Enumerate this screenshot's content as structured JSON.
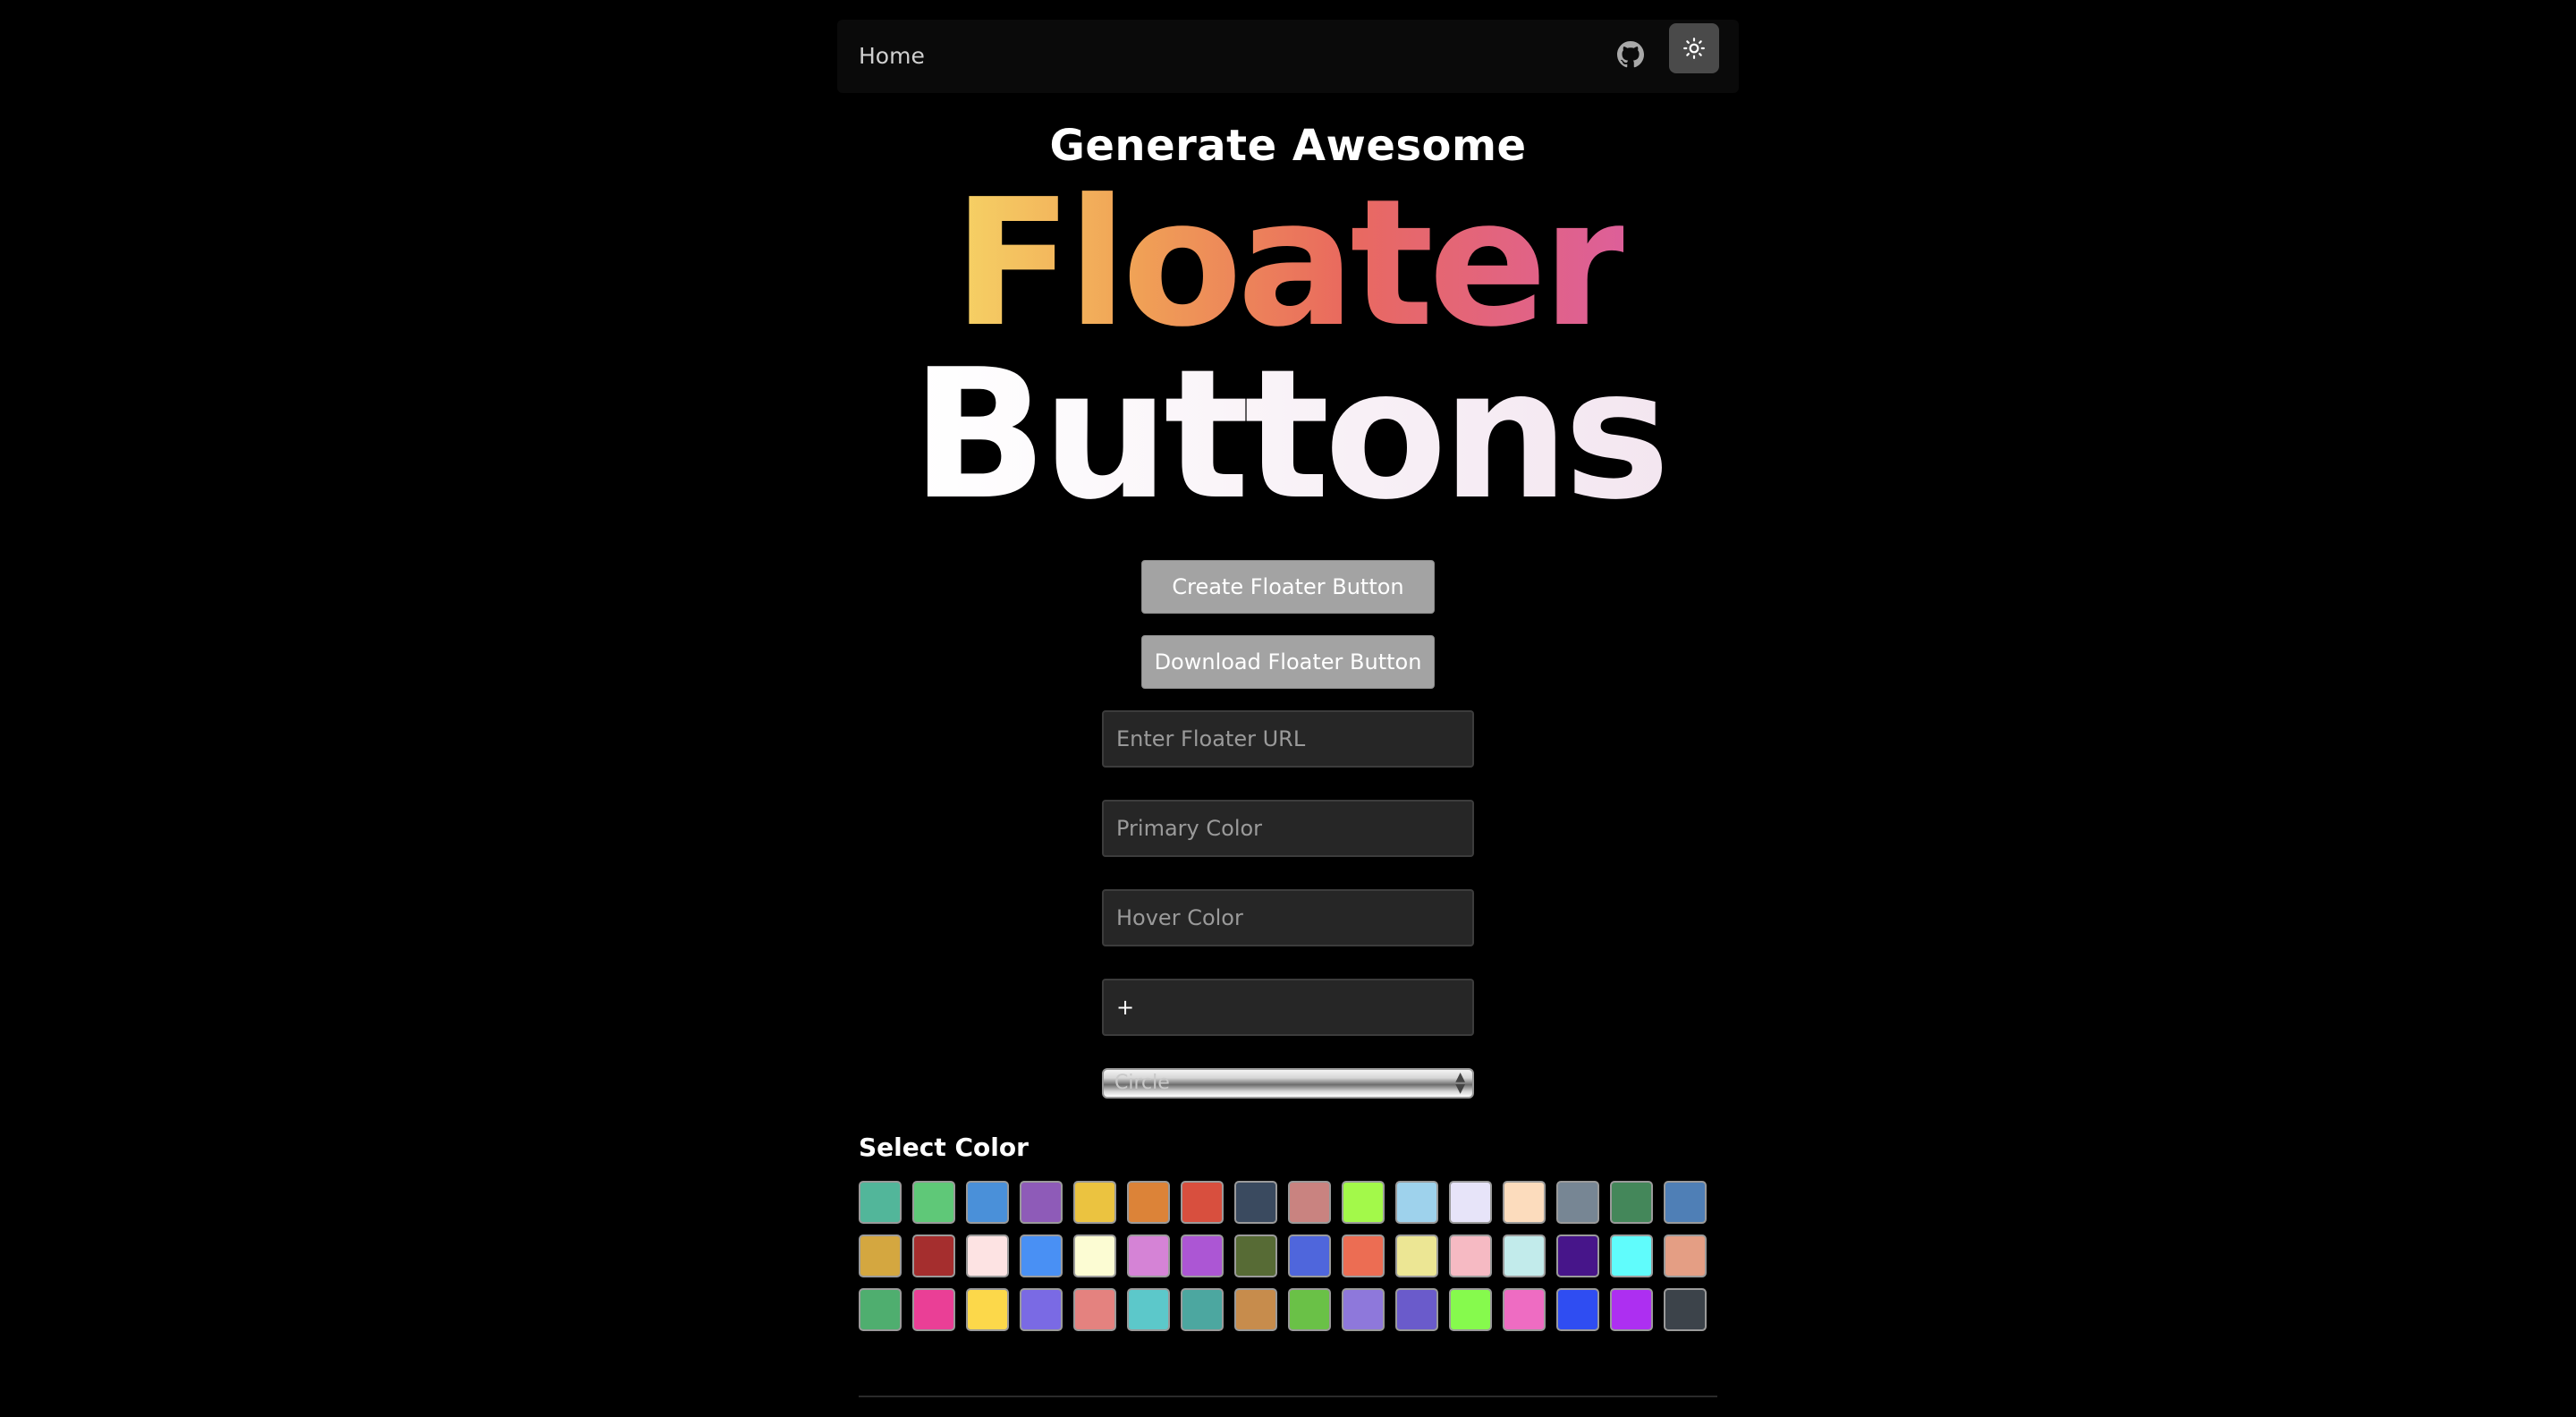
{
  "nav": {
    "home_label": "Home"
  },
  "hero": {
    "subtitle": "Generate Awesome",
    "line1": "Floater",
    "line2": "Buttons"
  },
  "actions": {
    "create_label": "Create Floater Button",
    "download_label": "Download Floater Button"
  },
  "form": {
    "url_placeholder": "Enter Floater URL",
    "primary_placeholder": "Primary Color",
    "hover_placeholder": "Hover Color",
    "icon_value": "+",
    "shape_selected": "Circle"
  },
  "palette": {
    "title": "Select Color",
    "colors": [
      "#52b69a",
      "#5fc878",
      "#4a90d9",
      "#8e5bb8",
      "#ebc340",
      "#dc8338",
      "#d84f3e",
      "#3a4a5f",
      "#c98380",
      "#a3f94a",
      "#9ed2ec",
      "#e7e4f9",
      "#fcdcbd",
      "#778694",
      "#44875a",
      "#4f7fb6",
      "#d4a740",
      "#a52e2e",
      "#fde3e3",
      "#4990f4",
      "#fcfcd3",
      "#d583d6",
      "#ac56d4",
      "#576b35",
      "#4f66dc",
      "#ec6d53",
      "#ece694",
      "#f6bac3",
      "#c2ebeb",
      "#47158a",
      "#60fcfc",
      "#e49e84",
      "#4fae6f",
      "#ea3f96",
      "#fcd84a",
      "#7a6ae4",
      "#e4827f",
      "#5cc8ca",
      "#4ca7a0",
      "#c78c4c",
      "#6ac147",
      "#8e78db",
      "#6a5bcb",
      "#86fa4d",
      "#ee6cc2",
      "#2f4df2",
      "#ad2ff1",
      "#3c434a"
    ]
  }
}
